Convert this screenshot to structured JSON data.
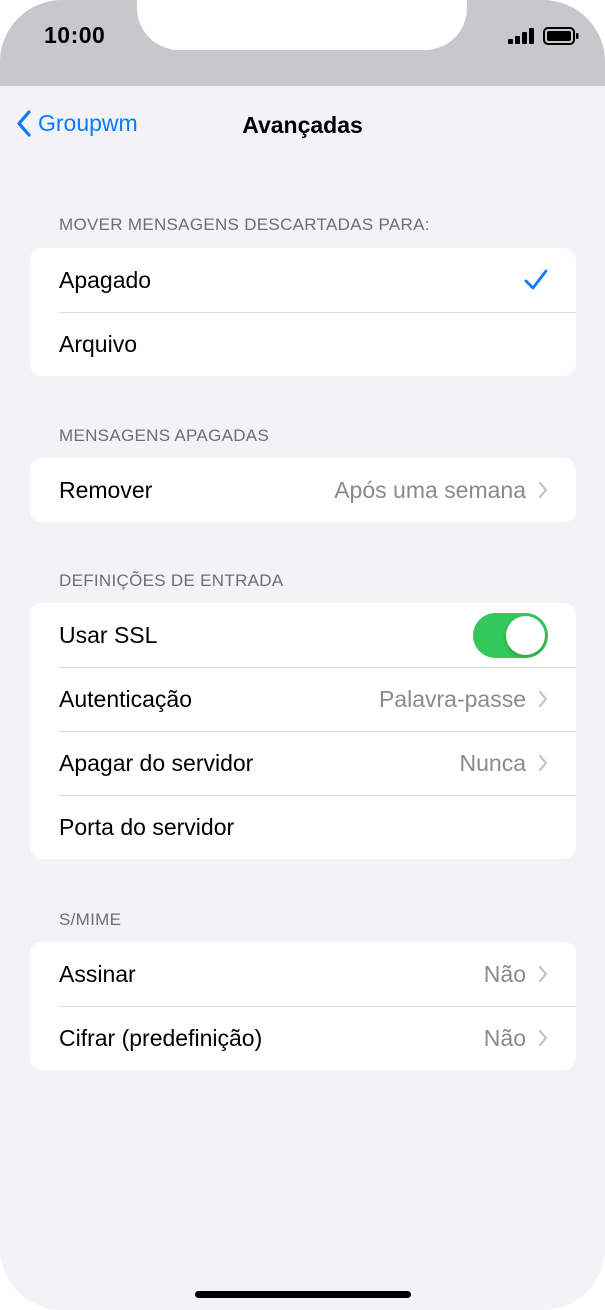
{
  "status_bar": {
    "time": "10:00",
    "icons": [
      "signal-icon",
      "battery-icon"
    ]
  },
  "navbar": {
    "back_label": "Groupwm",
    "title": "Avançadas"
  },
  "colors": {
    "accent": "#0a7aff",
    "toggle_on": "#34c759",
    "background": "#f2f2f7",
    "secondary_text": "#8a8a8e"
  },
  "sections": {
    "move_discarded": {
      "header": "MOVER MENSAGENS DESCARTADAS PARA:",
      "rows": [
        {
          "label": "Apagado",
          "selected": true
        },
        {
          "label": "Arquivo",
          "selected": false
        }
      ]
    },
    "deleted_messages": {
      "header": "MENSAGENS APAGADAS",
      "rows": [
        {
          "label": "Remover",
          "value": "Após uma semana"
        }
      ]
    },
    "incoming_settings": {
      "header": "DEFINIÇÕES DE ENTRADA",
      "rows": [
        {
          "label": "Usar SSL",
          "toggle_on": true
        },
        {
          "label": "Autenticação",
          "value": "Palavra-passe"
        },
        {
          "label": "Apagar do servidor",
          "value": "Nunca"
        },
        {
          "label": "Porta do servidor",
          "value": ""
        }
      ]
    },
    "smime": {
      "header": "S/MIME",
      "rows": [
        {
          "label": "Assinar",
          "value": "Não"
        },
        {
          "label": "Cifrar (predefinição)",
          "value": "Não"
        }
      ]
    }
  }
}
